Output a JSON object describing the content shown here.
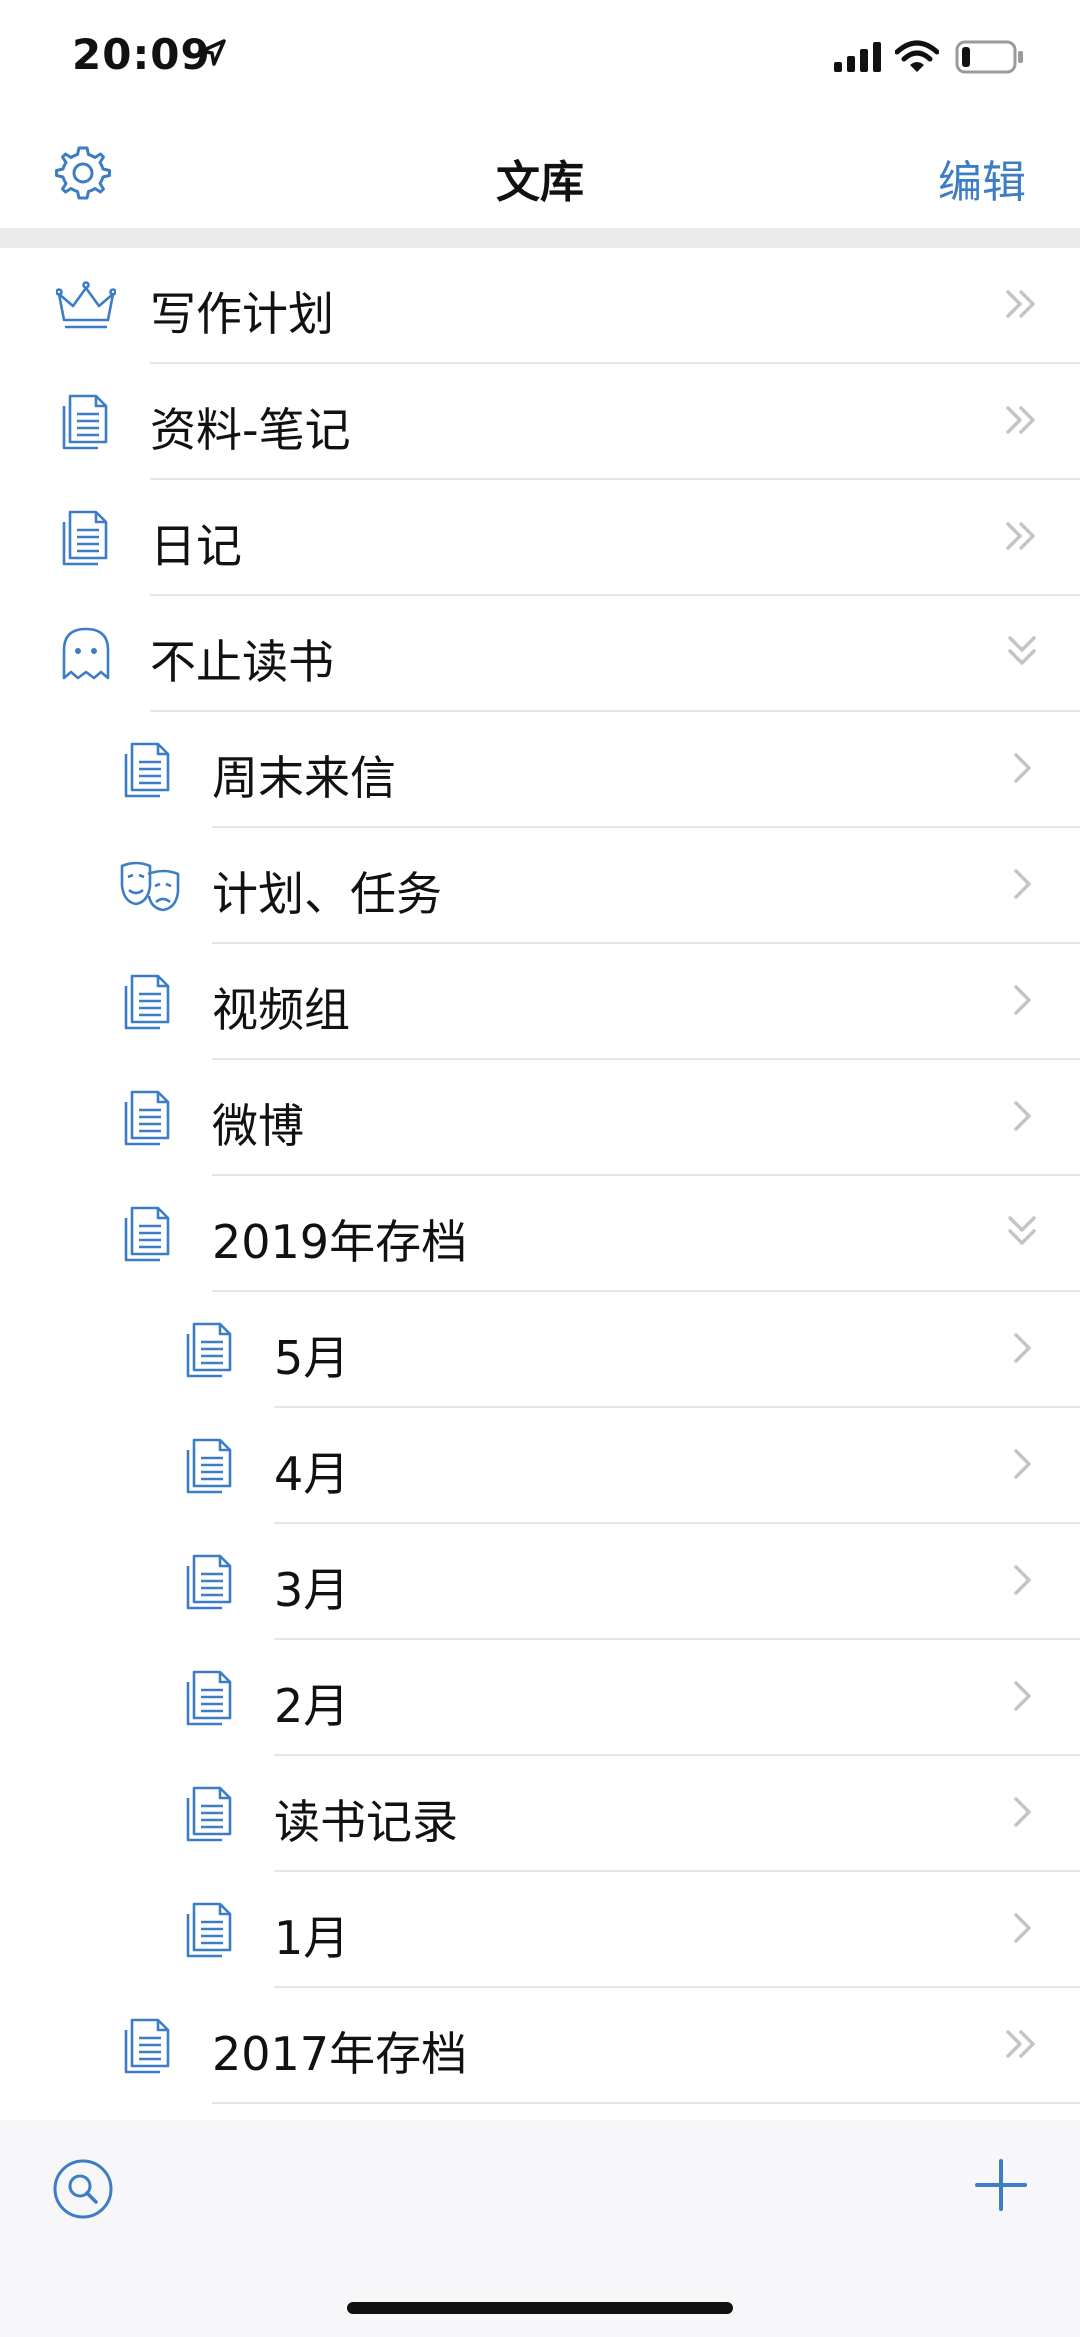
{
  "status": {
    "time": "20:09"
  },
  "nav": {
    "title": "文库",
    "edit_label": "编辑"
  },
  "colors": {
    "accent": "#3c7dc4",
    "chevron": "#c4c4c8",
    "divider": "#e6e6e8"
  },
  "rows": [
    {
      "label": "写作计划",
      "icon": "crown-icon",
      "level": 0,
      "chevron": "double-right"
    },
    {
      "label": "资料-笔记",
      "icon": "document-icon",
      "level": 0,
      "chevron": "double-right"
    },
    {
      "label": "日记",
      "icon": "document-icon",
      "level": 0,
      "chevron": "double-right"
    },
    {
      "label": "不止读书",
      "icon": "ghost-icon",
      "level": 0,
      "chevron": "double-down"
    },
    {
      "label": "周末来信",
      "icon": "document-icon",
      "level": 1,
      "chevron": "single-right"
    },
    {
      "label": "计划、任务",
      "icon": "theater-masks-icon",
      "level": 1,
      "chevron": "single-right"
    },
    {
      "label": "视频组",
      "icon": "document-icon",
      "level": 1,
      "chevron": "single-right"
    },
    {
      "label": "微博",
      "icon": "document-icon",
      "level": 1,
      "chevron": "single-right"
    },
    {
      "label": "2019年存档",
      "icon": "document-icon",
      "level": 1,
      "chevron": "double-down"
    },
    {
      "label": "5月",
      "icon": "document-icon",
      "level": 2,
      "chevron": "single-right"
    },
    {
      "label": "4月",
      "icon": "document-icon",
      "level": 2,
      "chevron": "single-right"
    },
    {
      "label": "3月",
      "icon": "document-icon",
      "level": 2,
      "chevron": "single-right"
    },
    {
      "label": "2月",
      "icon": "document-icon",
      "level": 2,
      "chevron": "single-right"
    },
    {
      "label": "读书记录",
      "icon": "document-icon",
      "level": 2,
      "chevron": "single-right"
    },
    {
      "label": "1月",
      "icon": "document-icon",
      "level": 2,
      "chevron": "single-right"
    },
    {
      "label": "2017年存档",
      "icon": "document-icon",
      "level": 1,
      "chevron": "double-right"
    }
  ],
  "toolbar": {
    "search_icon": "search-icon",
    "add_icon": "plus-icon"
  }
}
